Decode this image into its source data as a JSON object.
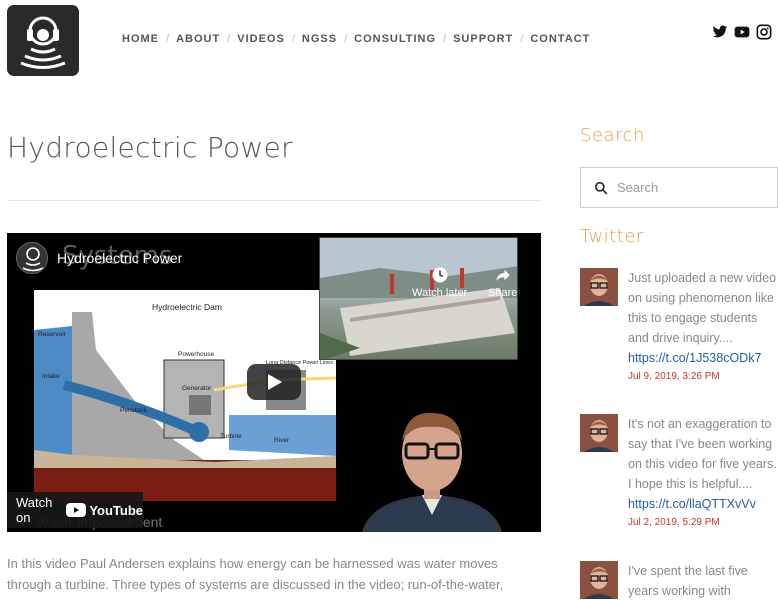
{
  "nav": {
    "items": [
      "HOME",
      "ABOUT",
      "VIDEOS",
      "NGSS",
      "CONSULTING",
      "SUPPORT",
      "CONTACT"
    ]
  },
  "social": {
    "icons": [
      "twitter-icon",
      "youtube-icon",
      "instagram-icon"
    ]
  },
  "main": {
    "title": "Hydroelectric Power",
    "video": {
      "title": "Hydroelectric Power",
      "background_word": "Systems",
      "diagram_title": "Hydroelectric Dam",
      "diagram_labels": {
        "reservoir": "Reservoir",
        "intake": "Intake",
        "powerhouse": "Powerhouse",
        "generator": "Generator",
        "penstock": "Penstock",
        "turbine": "Turbine",
        "river": "River",
        "power_lines": "Long Distance Power Lines"
      },
      "watch_later": "Watch later",
      "share": "Share",
      "watch_on": "Watch on",
      "youtube": "YouTube",
      "caption": "Water Impoundment"
    },
    "description": "In this video Paul Andersen explains how energy can be harnessed was water moves through a turbine. Three types of systems are discussed in the video; run-of-the-water, impoundment, and tidal. Several advantages and disadvantages of dams are discussed."
  },
  "sidebar": {
    "search_heading": "Search",
    "search_placeholder": "Search",
    "twitter_heading": "Twitter",
    "tweets": [
      {
        "text": "Just uploaded a new video on using phenomenon like this to engage students and drive inquiry....",
        "link": "https://t.co/1J538cODk7",
        "date": "Jul 9, 2019, 3:26 PM"
      },
      {
        "text": "It's not an exaggeration to say that I've been working on this video for five years. I hope this is helpful....",
        "link": "https://t.co/llaQTTXvVv",
        "date": "Jul 2, 2019, 5:29 PM"
      },
      {
        "text": "I've spent the last five years working with",
        "link": "",
        "date": ""
      }
    ]
  }
}
